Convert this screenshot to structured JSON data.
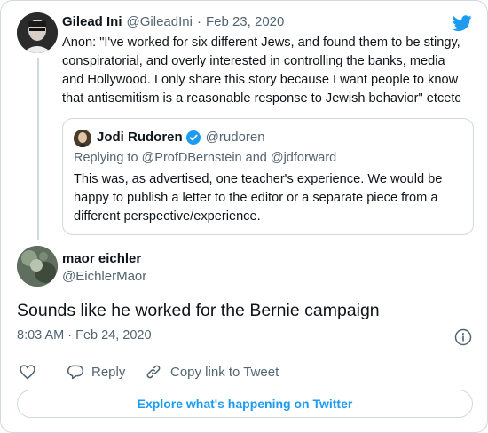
{
  "parent_tweet": {
    "name": "Gilead Ini",
    "handle": "@GileadIni",
    "separator": "·",
    "date": "Feb 23, 2020",
    "lines": [
      "Anon: \"I've worked for six different Jews, and found them to be stingy,",
      "conspiratorial, and overly interested in controlling the banks, media",
      "and Hollywood. I only share this story because I want people to know",
      "that antisemitism is a reasonable response to Jewish behavior\" etcetc"
    ]
  },
  "quoted_tweet": {
    "name": "Jodi Rudoren",
    "handle": "@rudoren",
    "verified": true,
    "replying_to": "Replying to @ProfDBernstein and @jdforward",
    "lines": [
      "This was, as advertised, one teacher's experience. We would be",
      "happy to publish a letter to the editor or a separate piece from a",
      "different perspective/experience."
    ]
  },
  "main_tweet": {
    "name": "maor eichler",
    "handle": "@EichlerMaor",
    "text": "Sounds like he worked for the Bernie campaign",
    "timestamp": "8:03 AM · Feb 24, 2020"
  },
  "actions": {
    "reply_label": "Reply",
    "copy_label": "Copy link to Tweet"
  },
  "explore_label": "Explore what's happening on Twitter",
  "colors": {
    "twitter_blue": "#1d9bf0",
    "verified_blue": "#1d9bf0",
    "muted": "#536471",
    "border": "#cfd9de"
  }
}
